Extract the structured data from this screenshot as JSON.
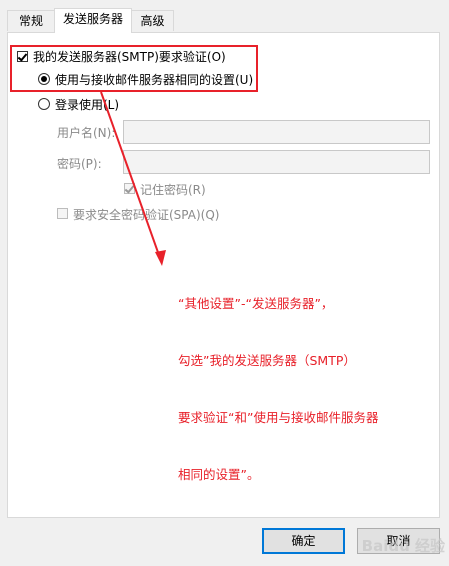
{
  "tabs": [
    {
      "label": "常规"
    },
    {
      "label": "发送服务器"
    },
    {
      "label": "高级"
    }
  ],
  "smtp": {
    "auth_checkbox_label": "我的发送服务器(SMTP)要求验证(O)",
    "auth_checked": true,
    "same_settings_label": "使用与接收邮件服务器相同的设置(U)",
    "login_label": "登录使用(L)",
    "username_label": "用户名(N):",
    "username_value": "",
    "password_label": "密码(P):",
    "password_value": "",
    "remember_label": "记住密码(R)",
    "spa_label": "要求安全密码验证(SPA)(Q)"
  },
  "annotation": {
    "lines": [
      "“其他设置”-“发送服务器”，",
      "勾选”我的发送服务器（SMTP）",
      "要求验证“和”使用与接收邮件服务器",
      "相同的设置”。"
    ],
    "color": "#e8212a"
  },
  "buttons": {
    "ok": "确定",
    "cancel": "取消"
  },
  "watermark": "Baidu 经验"
}
